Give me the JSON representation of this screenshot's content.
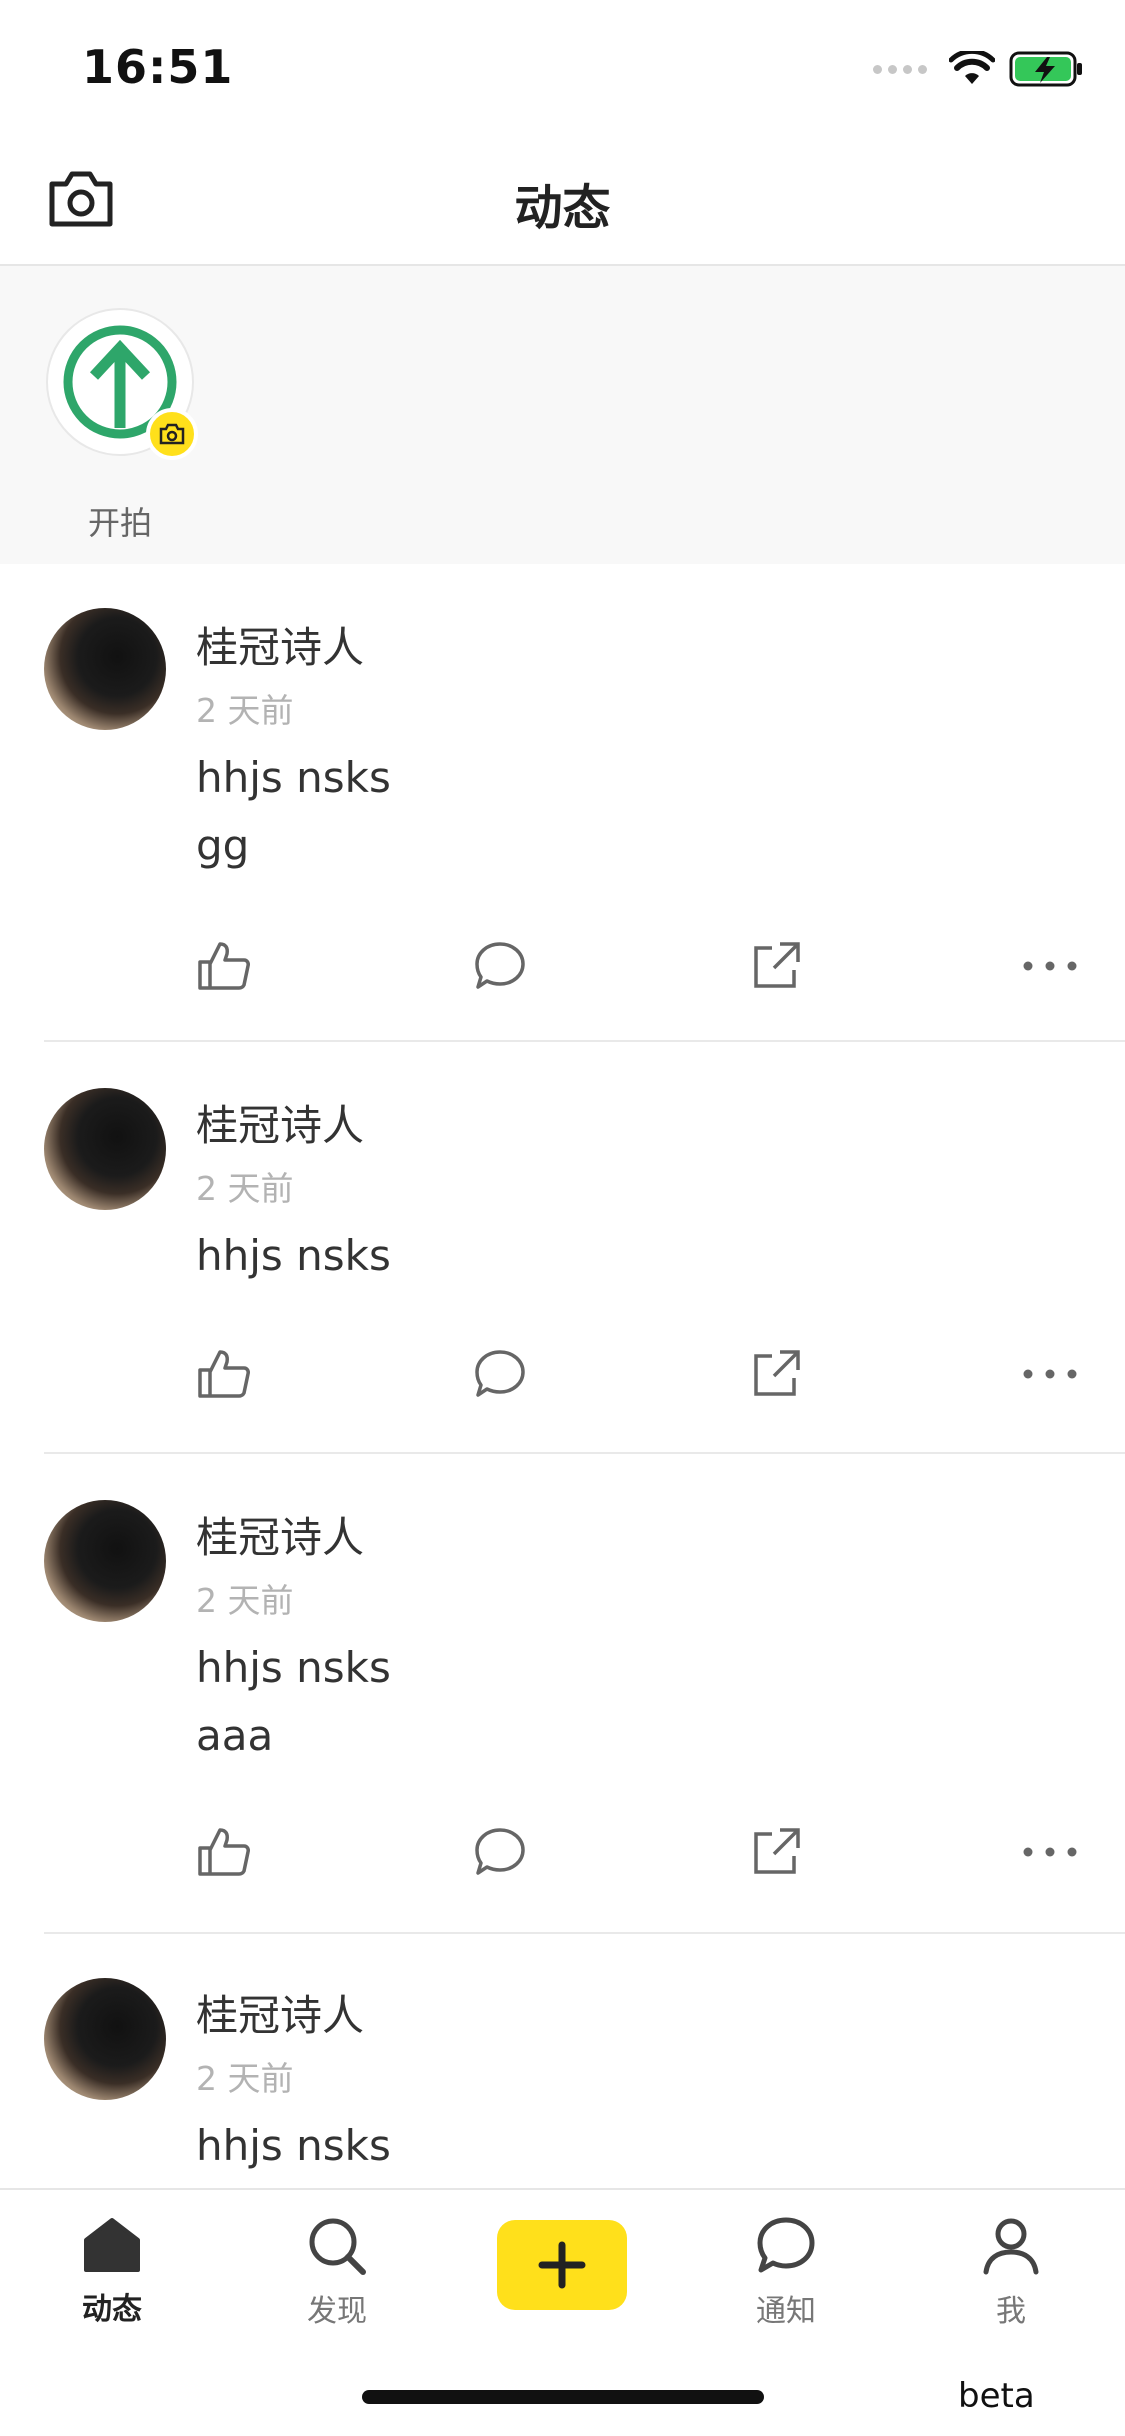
{
  "status_bar": {
    "time": "16:51"
  },
  "nav": {
    "title": "动态"
  },
  "stories": {
    "items": [
      {
        "label": "开拍"
      }
    ]
  },
  "posts": [
    {
      "author": "桂冠诗人",
      "time": "2 天前",
      "lines": [
        "hhjs nsks",
        "gg"
      ]
    },
    {
      "author": "桂冠诗人",
      "time": "2 天前",
      "lines": [
        "hhjs nsks"
      ]
    },
    {
      "author": "桂冠诗人",
      "time": "2 天前",
      "lines": [
        "hhjs nsks",
        "aaa"
      ]
    },
    {
      "author": "桂冠诗人",
      "time": "2 天前",
      "lines": [
        "hhjs nsks"
      ]
    }
  ],
  "tabs": [
    {
      "label": "动态",
      "icon": "home-icon",
      "active": true
    },
    {
      "label": "发现",
      "icon": "search-icon"
    },
    {
      "label": "",
      "icon": "plus-icon"
    },
    {
      "label": "通知",
      "icon": "chat-bubble-icon"
    },
    {
      "label": "我",
      "icon": "user-icon"
    }
  ],
  "footer": {
    "beta_label": "beta"
  },
  "colors": {
    "accent_yellow": "#ffe01b",
    "logo_green": "#2ea66a",
    "battery_green": "#34c759"
  }
}
